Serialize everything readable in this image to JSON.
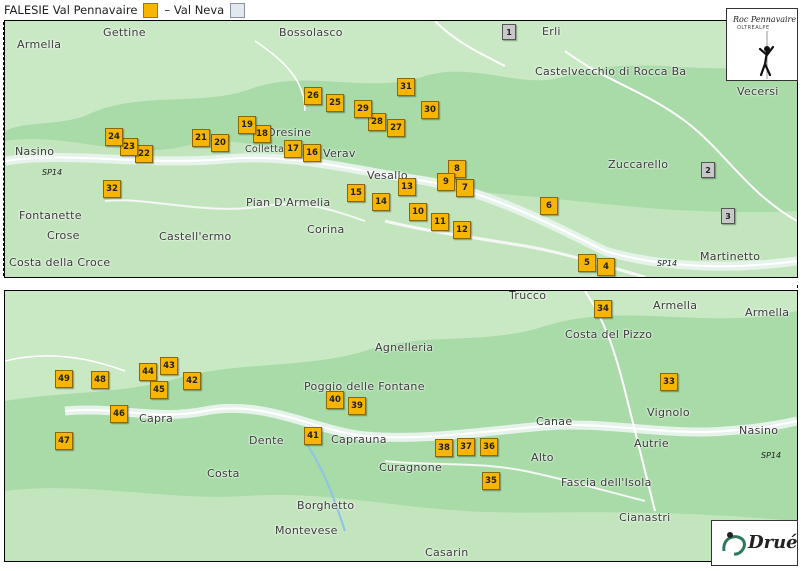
{
  "legend": {
    "prefix": "FALESIE Val Pennavaire",
    "separator": "– Val Neva",
    "colors": {
      "pennavaire": "#f7b500",
      "neva": "#e4e8ee"
    }
  },
  "map1": {
    "places": [
      {
        "text": "Gettine"
      },
      {
        "text": "Bossolasco"
      },
      {
        "text": "Erli"
      },
      {
        "text": "Armella"
      },
      {
        "text": "Castelvecchio di Rocca Ba"
      },
      {
        "text": "Vecersi"
      },
      {
        "text": "Oresine"
      },
      {
        "text": "Colletta"
      },
      {
        "text": "Verav"
      },
      {
        "text": "Nasino"
      },
      {
        "text": "Vesallo"
      },
      {
        "text": "Zuccarello"
      },
      {
        "text": "Pian D'Armelia"
      },
      {
        "text": "Fontanette"
      },
      {
        "text": "Crose"
      },
      {
        "text": "Castell'ermo"
      },
      {
        "text": "Corina"
      },
      {
        "text": "Costa della Croce"
      },
      {
        "text": "Martinetto"
      }
    ],
    "roads": [
      {
        "text": "SP14"
      },
      {
        "text": "SP14"
      }
    ],
    "markers": [
      {
        "n": "1",
        "kind": "neva"
      },
      {
        "n": "2",
        "kind": "neva"
      },
      {
        "n": "3",
        "kind": "neva"
      },
      {
        "n": "4"
      },
      {
        "n": "5"
      },
      {
        "n": "6"
      },
      {
        "n": "7"
      },
      {
        "n": "8"
      },
      {
        "n": "9"
      },
      {
        "n": "10"
      },
      {
        "n": "11"
      },
      {
        "n": "12"
      },
      {
        "n": "13"
      },
      {
        "n": "14"
      },
      {
        "n": "15"
      },
      {
        "n": "16"
      },
      {
        "n": "17"
      },
      {
        "n": "18"
      },
      {
        "n": "19"
      },
      {
        "n": "20"
      },
      {
        "n": "21"
      },
      {
        "n": "22"
      },
      {
        "n": "23"
      },
      {
        "n": "24"
      },
      {
        "n": "25"
      },
      {
        "n": "26"
      },
      {
        "n": "27"
      },
      {
        "n": "28"
      },
      {
        "n": "29"
      },
      {
        "n": "30"
      },
      {
        "n": "31"
      },
      {
        "n": "32"
      }
    ]
  },
  "map2": {
    "places": [
      {
        "text": "Trucco"
      },
      {
        "text": "Armella"
      },
      {
        "text": "Armella"
      },
      {
        "text": "Costa del Pizzo"
      },
      {
        "text": "Agnelleria"
      },
      {
        "text": "Poggio delle Fontane"
      },
      {
        "text": "Capra"
      },
      {
        "text": "Vignolo"
      },
      {
        "text": "Canae"
      },
      {
        "text": "Nasino"
      },
      {
        "text": "Dente"
      },
      {
        "text": "Caprauna"
      },
      {
        "text": "Autrie"
      },
      {
        "text": "Alto"
      },
      {
        "text": "Curagnone"
      },
      {
        "text": "Costa"
      },
      {
        "text": "Fascia dell'Isola"
      },
      {
        "text": "Borghetto"
      },
      {
        "text": "Cianastri"
      },
      {
        "text": "Montevese"
      },
      {
        "text": "Casarin"
      }
    ],
    "roads": [
      {
        "text": "SP14"
      }
    ],
    "markers": [
      {
        "n": "33"
      },
      {
        "n": "34"
      },
      {
        "n": "35"
      },
      {
        "n": "36"
      },
      {
        "n": "37"
      },
      {
        "n": "38"
      },
      {
        "n": "39"
      },
      {
        "n": "40"
      },
      {
        "n": "41"
      },
      {
        "n": "42"
      },
      {
        "n": "43"
      },
      {
        "n": "44"
      },
      {
        "n": "45"
      },
      {
        "n": "46"
      },
      {
        "n": "47"
      },
      {
        "n": "48"
      },
      {
        "n": "49"
      }
    ]
  },
  "logos": {
    "top": {
      "title": "Roc Pennavaire",
      "subtitle": "OLTREALPE"
    },
    "bottom": {
      "text": "Drué"
    }
  }
}
